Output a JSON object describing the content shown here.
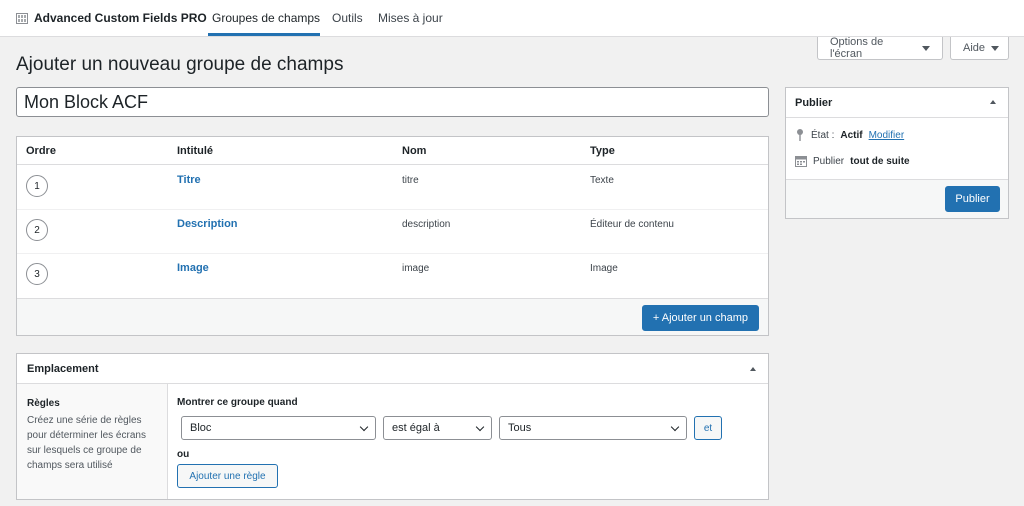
{
  "nav": {
    "brand": "Advanced Custom Fields PRO",
    "tabs": [
      {
        "label": "Groupes de champs",
        "active": true
      },
      {
        "label": "Outils",
        "active": false
      },
      {
        "label": "Mises à jour",
        "active": false
      }
    ]
  },
  "screen_meta": {
    "screen_options": "Options de l'écran",
    "help": "Aide"
  },
  "page": {
    "title": "Ajouter un nouveau groupe de champs",
    "group_title_value": "Mon Block ACF"
  },
  "fields": {
    "headers": {
      "order": "Ordre",
      "label": "Intitulé",
      "name": "Nom",
      "type": "Type"
    },
    "rows": [
      {
        "order": "1",
        "label": "Titre",
        "name": "titre",
        "type": "Texte"
      },
      {
        "order": "2",
        "label": "Description",
        "name": "description",
        "type": "Éditeur de contenu"
      },
      {
        "order": "3",
        "label": "Image",
        "name": "image",
        "type": "Image"
      }
    ],
    "add_button": "+ Ajouter un champ"
  },
  "location": {
    "title": "Emplacement",
    "rules_title": "Règles",
    "rules_desc": "Créez une série de règles pour déterminer les écrans sur lesquels ce groupe de champs sera utilisé",
    "show_when": "Montrer ce groupe quand",
    "param": "Bloc",
    "operator": "est égal à",
    "value": "Tous",
    "and_button": "et",
    "or_label": "ou",
    "add_rule_button": "Ajouter une règle"
  },
  "publish": {
    "title": "Publier",
    "status_label": "État :",
    "status_value": "Actif",
    "edit_link": "Modifier",
    "publish_label": "Publier",
    "publish_value": "tout de suite",
    "button": "Publier"
  },
  "colors": {
    "accent": "#2271b1",
    "background": "#f1f1f1"
  }
}
